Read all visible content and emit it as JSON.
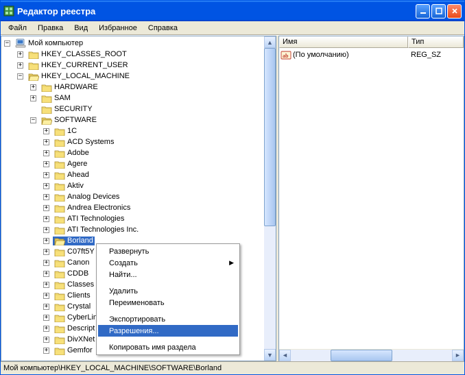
{
  "window": {
    "title": "Редактор реестра"
  },
  "menu": {
    "file": "Файл",
    "edit": "Правка",
    "view": "Вид",
    "favorites": "Избранное",
    "help": "Справка"
  },
  "tree": {
    "root": "Мой компьютер",
    "hkcr": "HKEY_CLASSES_ROOT",
    "hkcu": "HKEY_CURRENT_USER",
    "hklm": "HKEY_LOCAL_MACHINE",
    "hardware": "HARDWARE",
    "sam": "SAM",
    "security": "SECURITY",
    "software": "SOFTWARE",
    "sw": {
      "n0": "1C",
      "n1": "ACD Systems",
      "n2": "Adobe",
      "n3": "Agere",
      "n4": "Ahead",
      "n5": "Aktiv",
      "n6": "Analog Devices",
      "n7": "Andrea Electronics",
      "n8": "ATI Technologies",
      "n9": "ATI Technologies Inc.",
      "n10": "Borland",
      "n11": "C07ft5Y",
      "n12": "Canon",
      "n13": "CDDB",
      "n14": "Classes",
      "n15": "Clients",
      "n16": "Crystal",
      "n17": "CyberLin",
      "n18": "Descript",
      "n19": "DivXNet",
      "n20": "Gemfor"
    }
  },
  "columns": {
    "name": "Имя",
    "type": "Тип"
  },
  "values": {
    "default_name": "(По умолчанию)",
    "default_type": "REG_SZ"
  },
  "context_menu": {
    "expand": "Развернуть",
    "new": "Создать",
    "find": "Найти...",
    "delete": "Удалить",
    "rename": "Переименовать",
    "export": "Экспортировать",
    "permissions": "Разрешения...",
    "copy_key": "Копировать имя раздела"
  },
  "statusbar": {
    "path": "Мой компьютер\\HKEY_LOCAL_MACHINE\\SOFTWARE\\Borland"
  }
}
